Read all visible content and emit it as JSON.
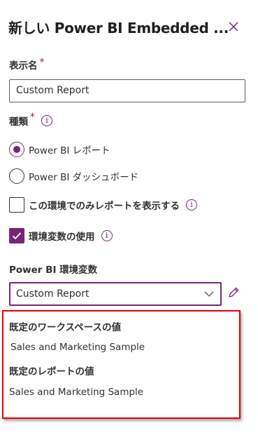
{
  "header": {
    "title": "新しい Power BI Embedded ...",
    "close_icon": "close-icon"
  },
  "fields": {
    "display_name": {
      "label": "表示名",
      "required_mark": "*",
      "value": "Custom Report"
    },
    "type": {
      "label": "種類",
      "required_mark": "*",
      "info_icon": "info-icon",
      "options": [
        {
          "label": "Power BI レポート",
          "selected": true
        },
        {
          "label": "Power BI ダッシュボード",
          "selected": false
        }
      ]
    },
    "env_only": {
      "label": "この環境でのみレポートを表示する",
      "checked": false,
      "info_icon": "info-icon"
    },
    "use_env_var": {
      "label": "環境変数の使用",
      "checked": true,
      "info_icon": "info-icon"
    },
    "env_var": {
      "label": "Power BI 環境変数",
      "selected": "Custom Report",
      "edit_icon": "pencil-icon"
    }
  },
  "defaults": {
    "workspace_label": "既定のワークスペースの値",
    "workspace_value": "Sales and Marketing Sample",
    "report_label": "既定のレポートの値",
    "report_value": "Sales and Marketing Sample"
  },
  "colors": {
    "accent": "#742774",
    "highlight_border": "#e60000"
  }
}
